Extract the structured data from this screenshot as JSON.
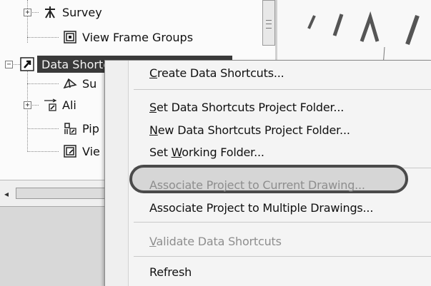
{
  "tree": {
    "nodes": [
      {
        "label": "Survey",
        "icon": "survey-icon"
      },
      {
        "label": "View Frame Groups",
        "icon": "view-frame-groups-icon"
      },
      {
        "label": "Data Shortcuts [C:\\Training\\Tra...",
        "icon": "data-shortcuts-icon"
      },
      {
        "label": "Su",
        "icon": "surfaces-icon"
      },
      {
        "label": "Ali",
        "icon": "alignments-icon"
      },
      {
        "label": "Pip",
        "icon": "pipe-networks-icon"
      },
      {
        "label": "Vie",
        "icon": "view-frame-groups-icon"
      }
    ]
  },
  "context_menu": {
    "items": [
      {
        "pre": "",
        "mn": "C",
        "post": "reate Data Shortcuts...",
        "enabled": true
      },
      {
        "pre": "",
        "mn": "S",
        "post": "et Data Shortcuts Project Folder...",
        "enabled": true
      },
      {
        "pre": "",
        "mn": "N",
        "post": "ew Data Shortcuts Project Folder...",
        "enabled": true
      },
      {
        "pre": "Set ",
        "mn": "W",
        "post": "orking Folder...",
        "enabled": true
      },
      {
        "pre": "Associate Project to Current Drawing...",
        "mn": "",
        "post": "",
        "enabled": false
      },
      {
        "pre": "Associate Project to Multiple Drawings...",
        "mn": "",
        "post": "",
        "enabled": true
      },
      {
        "pre": "",
        "mn": "V",
        "post": "alidate Data Shortcuts",
        "enabled": false
      },
      {
        "pre": "Refresh",
        "mn": "",
        "post": "",
        "enabled": true
      }
    ]
  },
  "colors": {
    "highlight_outline": "#4a4a4a",
    "disabled_text": "#8e8e8e",
    "selected_node_bg": "#3a3a3a"
  }
}
